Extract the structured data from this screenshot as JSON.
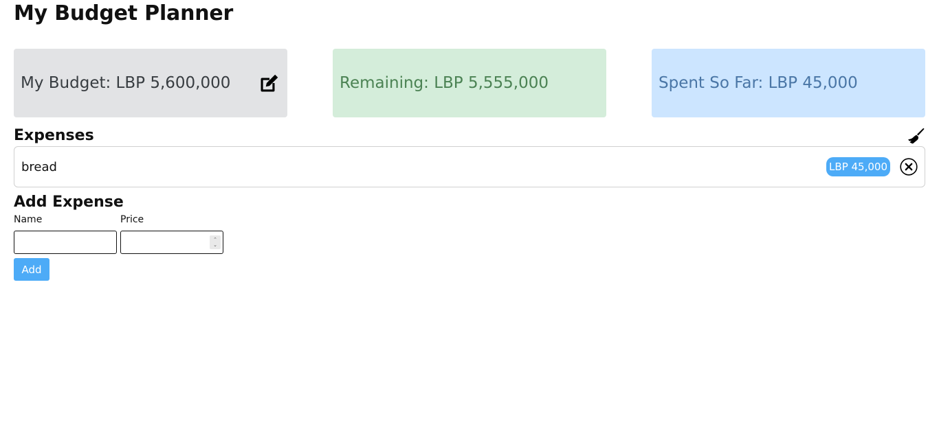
{
  "app": {
    "title": "My Budget Planner"
  },
  "cards": {
    "budget": "My Budget: LBP 5,600,000",
    "remaining": "Remaining: LBP 5,555,000",
    "spent": "Spent So Far: LBP 45,000"
  },
  "expenses": {
    "heading": "Expenses",
    "items": [
      {
        "name": "bread",
        "amount": "LBP 45,000"
      }
    ]
  },
  "add_form": {
    "heading": "Add Expense",
    "name_label": "Name",
    "name_value": "",
    "price_label": "Price",
    "price_value": "",
    "submit_label": "Add"
  },
  "icons": {
    "edit": "edit-icon",
    "clear": "broom-icon",
    "delete": "close-circle-icon"
  },
  "colors": {
    "budget_bg": "#e2e3e5",
    "remaining_bg": "#d4edda",
    "spent_bg": "#cce5ff",
    "accent": "#4dabf7"
  }
}
